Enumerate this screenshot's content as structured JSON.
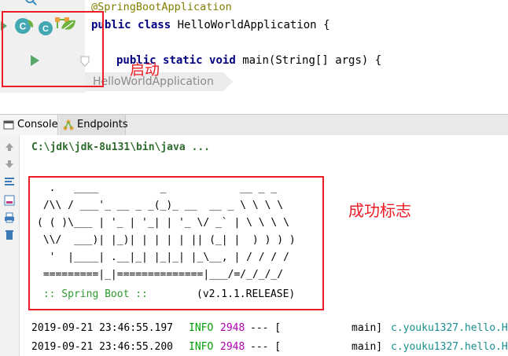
{
  "editor": {
    "annotation": "@SpringBootApplication",
    "class_kw1": "public",
    "class_kw2": "class",
    "class_name": "HelloWorldApplication",
    "class_brace": "{",
    "main_kw1": "public",
    "main_kw2": "static",
    "main_kw3": "void",
    "main_sig": "main(String[] args) {",
    "breadcrumb": "HelloWorldApplication",
    "annotation_label": "启动"
  },
  "tool_tabs": [
    {
      "label": "Console",
      "icon": "console-icon"
    },
    {
      "label": "Endpoints",
      "icon": "endpoints-icon"
    }
  ],
  "console": {
    "command": "C:\\jdk\\jdk-8u131\\bin\\java ...",
    "banner_lines": [
      "  .   ____          _            __ _ _",
      " /\\\\ / ___'_ __ _ _(_)_ __  __ _ \\ \\ \\ \\",
      "( ( )\\___ | '_ | '_| | '_ \\/ _` | \\ \\ \\ \\",
      " \\\\/  ___)| |_)| | | | | || (_| |  ) ) ) )",
      "  '  |____| .__|_| |_|_| |_\\__, | / / / /",
      " =========|_|==============|___/=/_/_/_/"
    ],
    "banner_spring": " :: Spring Boot ::",
    "banner_version": "(v2.1.1.RELEASE)",
    "success_label": "成功标志",
    "logs": [
      {
        "ts": "2019-09-21 23:46:55.197",
        "level": "INFO",
        "pid": "2948",
        "sep": "--- [",
        "thread": "main]",
        "cls": "c.youku1327.hello.H"
      },
      {
        "ts": "2019-09-21 23:46:55.200",
        "level": "INFO",
        "pid": "2948",
        "sep": "--- [",
        "thread": "main]",
        "cls": "c.youku1327.hello.H"
      }
    ]
  },
  "colors": {
    "highlight_red": "#ee1c24",
    "spring_green": "#6db33f",
    "info_green": "#00a000",
    "pid_magenta": "#b000b0",
    "class_teal": "#1a8f8f"
  }
}
